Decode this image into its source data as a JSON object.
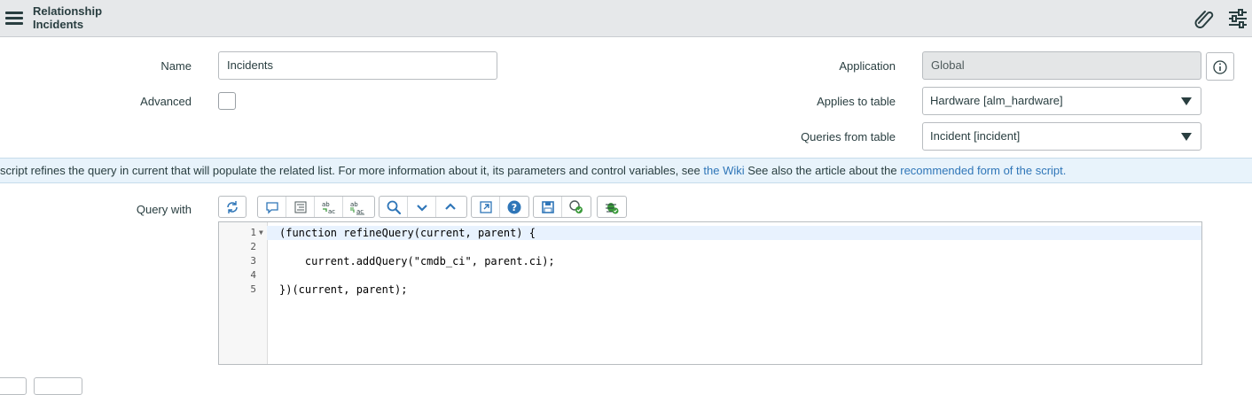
{
  "header": {
    "title_line1": "Relationship",
    "title_line2": "Incidents"
  },
  "form": {
    "name_label": "Name",
    "name_value": "Incidents",
    "advanced_label": "Advanced",
    "advanced_checked": false,
    "application_label": "Application",
    "application_value": "Global",
    "applies_to_label": "Applies to table",
    "applies_to_value": "Hardware [alm_hardware]",
    "queries_from_label": "Queries from table",
    "queries_from_value": "Incident [incident]",
    "query_with_label": "Query with"
  },
  "banner": {
    "text1": "script refines the query in current that will populate the related list. For more information about it, its parameters and control variables, see ",
    "link1": "the Wiki",
    "text2": " See also the article about the ",
    "link2": "recommended form of the script."
  },
  "editor": {
    "line_numbers": [
      "1",
      "2",
      "3",
      "4",
      "5"
    ],
    "lines": [
      "(function refineQuery(current, parent) {",
      "",
      "    current.addQuery(\"cmdb_ci\", parent.ci);",
      "",
      "})(current, parent);"
    ]
  },
  "toolbar_icons": [
    "toggle-syntax-icon",
    "comment-icon",
    "format-icon",
    "replace-icon",
    "replace-all-icon",
    "search-icon",
    "next-icon",
    "previous-icon",
    "fullscreen-icon",
    "help-icon",
    "save-icon",
    "script-check-icon",
    "debug-icon"
  ],
  "colors": {
    "header_bg": "#e6e8ea",
    "banner_bg": "#e8f3fb",
    "link": "#2f76b8",
    "icon_blue": "#2f76b8"
  }
}
